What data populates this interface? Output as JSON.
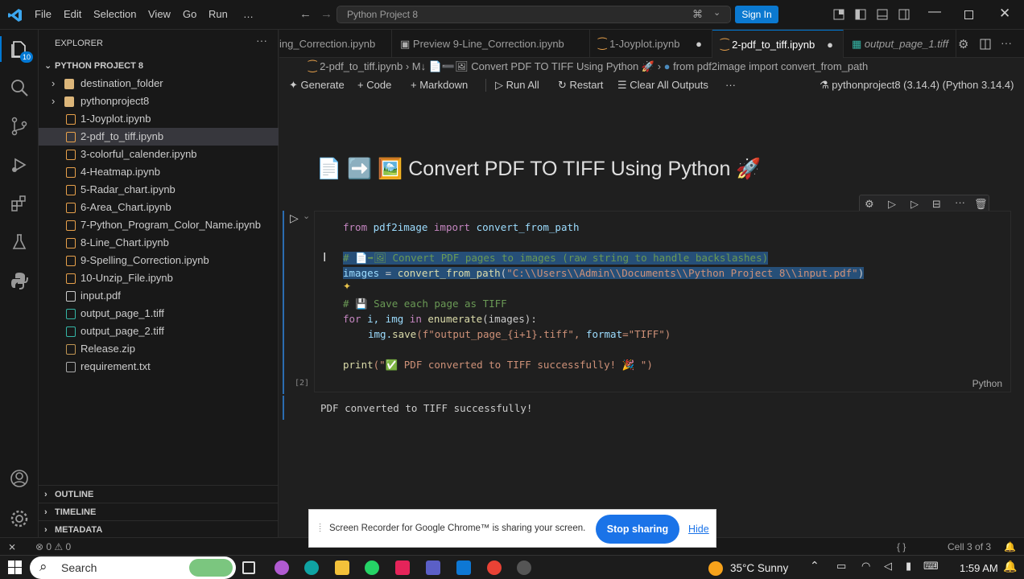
{
  "titlebar": {
    "menu": [
      "File",
      "Edit",
      "Selection",
      "View",
      "Go",
      "Run",
      "…"
    ],
    "search": "Python Project 8",
    "signin": "Sign In"
  },
  "sidebar": {
    "title": "EXPLORER",
    "project": "PYTHON PROJECT 8",
    "items": [
      {
        "label": "destination_folder",
        "type": "folder"
      },
      {
        "label": "pythonproject8",
        "type": "folder"
      },
      {
        "label": "1-Joyplot.ipynb",
        "type": "nb"
      },
      {
        "label": "2-pdf_to_tiff.ipynb",
        "type": "nb"
      },
      {
        "label": "3-colorful_calender.ipynb",
        "type": "nb"
      },
      {
        "label": "4-Heatmap.ipynb",
        "type": "nb"
      },
      {
        "label": "5-Radar_chart.ipynb",
        "type": "nb"
      },
      {
        "label": "6-Area_Chart.ipynb",
        "type": "nb"
      },
      {
        "label": "7-Python_Program_Color_Name.ipynb",
        "type": "nb"
      },
      {
        "label": "8-Line_Chart.ipynb",
        "type": "nb"
      },
      {
        "label": "9-Spelling_Correction.ipynb",
        "type": "nb"
      },
      {
        "label": "10-Unzip_File.ipynb",
        "type": "nb"
      },
      {
        "label": "input.pdf",
        "type": "pdf"
      },
      {
        "label": "output_page_1.tiff",
        "type": "img"
      },
      {
        "label": "output_page_2.tiff",
        "type": "img"
      },
      {
        "label": "Release.zip",
        "type": "zip"
      },
      {
        "label": "requirement.txt",
        "type": "txt"
      }
    ],
    "sections": [
      "OUTLINE",
      "TIMELINE",
      "METADATA"
    ],
    "badge": "10"
  },
  "tabs": [
    "ing_Correction.ipynb",
    "Preview 9-Line_Correction.ipynb",
    "1-Joyplot.ipynb",
    "2-pdf_to_tiff.ipynb",
    "output_page_1.tiff"
  ],
  "breadcrumbs": {
    "file": "2-pdf_to_tiff.ipynb",
    "md": "M↓",
    "title": "Convert PDF TO TIFF Using Python 🚀",
    "code": "from pdf2image import convert_from_path"
  },
  "toolbar": {
    "generate": "Generate",
    "code": "Code",
    "markdown": "Markdown",
    "runall": "Run All",
    "restart": "Restart",
    "clear": "Clear All Outputs",
    "more": "···",
    "kernel": "pythonproject8 (3.14.4) (Python 3.14.4)"
  },
  "markdown_heading": "Convert PDF TO TIFF Using Python",
  "cell": {
    "exec_count": "[2]",
    "lang": "Python",
    "line1": {
      "a": "from",
      "b": "pdf2image",
      "c": "import",
      "d": "convert_from_path"
    },
    "comment1": "# 📄➡🖼 Convert PDF pages to images (raw string to handle backslashes)",
    "line2": {
      "a": "images",
      "b": " = ",
      "c": "convert_from_path",
      "d": "(",
      "e": "\"C:\\\\Users\\\\Admin\\\\Documents\\\\Python Project 8\\\\input.pdf\"",
      "f": ")"
    },
    "comment2": "# 💾 Save each page as TIFF",
    "line3": {
      "a": "for",
      "b": " i, img ",
      "c": "in",
      "d": " enumerate",
      "e": "(images):"
    },
    "line4": {
      "a": "img.",
      "b": "save",
      "c": "(f\"output_page_{i+1}.tiff\", ",
      "d": "format",
      "e": "=\"TIFF\")"
    },
    "line5": {
      "a": "print",
      "b": "(\"✅ PDF converted to TIFF successfully! 🎉 \")"
    }
  },
  "output": "PDF converted to TIFF successfully!",
  "status": {
    "errors": "0",
    "warnings": "0",
    "cell": "Cell 3 of 3",
    "braces": "{ }"
  },
  "share": {
    "text": "Screen Recorder for Google Chrome™ is sharing your screen.",
    "stop": "Stop sharing",
    "hide": "Hide"
  },
  "taskbar": {
    "search": "Search",
    "weather": "35°C  Sunny",
    "time": "1:59 AM"
  },
  "colors": {
    "accent": "#0078d4",
    "signin": "#0b79d0",
    "stop": "#1a73e8"
  }
}
